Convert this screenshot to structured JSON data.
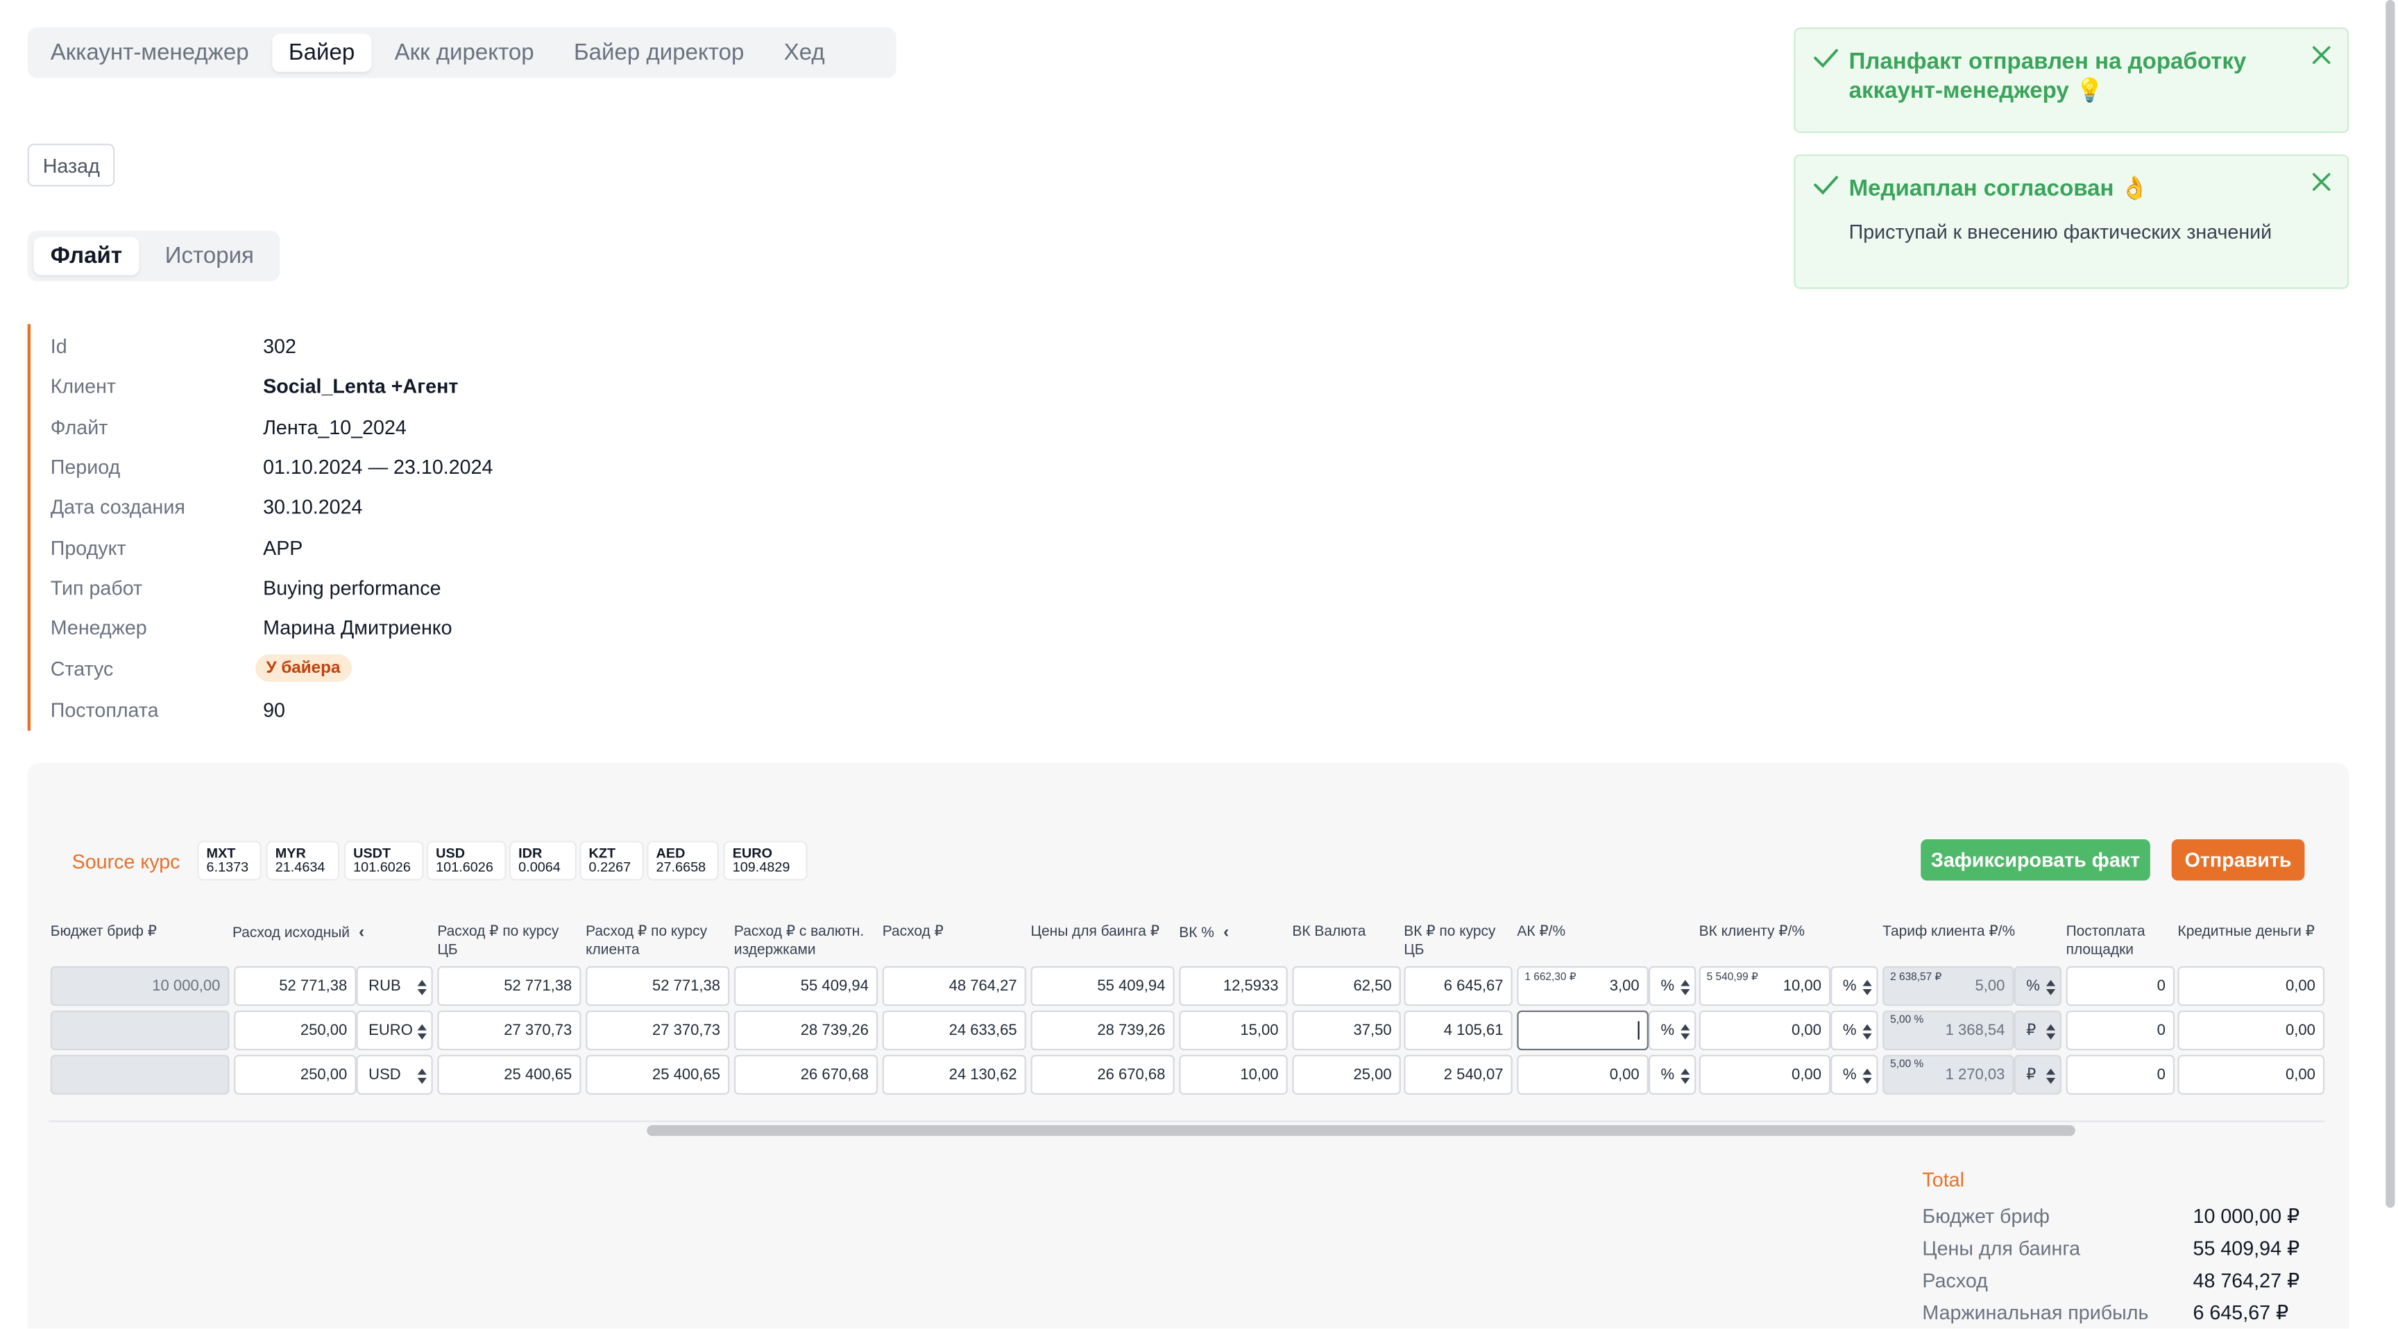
{
  "role_tabs": [
    {
      "label": "Аккаунт-менеджер",
      "active": false
    },
    {
      "label": "Байер",
      "active": true
    },
    {
      "label": "Акк директор",
      "active": false
    },
    {
      "label": "Байер директор",
      "active": false
    },
    {
      "label": "Хед",
      "active": false
    }
  ],
  "back_label": "Назад",
  "view_tabs": [
    {
      "label": "Флайт",
      "active": true
    },
    {
      "label": "История",
      "active": false
    }
  ],
  "info": [
    {
      "label": "Id",
      "value": "302"
    },
    {
      "label": "Клиент",
      "value": "Social_Lenta +Агент"
    },
    {
      "label": "Флайт",
      "value": "Лента_10_2024"
    },
    {
      "label": "Период",
      "value": "01.10.2024 — 23.10.2024"
    },
    {
      "label": "Дата создания",
      "value": "30.10.2024"
    },
    {
      "label": "Продукт",
      "value": "APP"
    },
    {
      "label": "Тип работ",
      "value": "Buying performance"
    },
    {
      "label": "Менеджер",
      "value": "Марина Дмитриенко"
    },
    {
      "label": "Статус",
      "value": "У байера"
    },
    {
      "label": "Постоплата",
      "value": "90"
    }
  ],
  "toasts": [
    {
      "title": "Планфакт отправлен на доработку аккаунт-менеджеру 💡",
      "desc": ""
    },
    {
      "title": "Медиаплан согласован 👌",
      "desc": "Приступай к внесению фактических значений"
    }
  ],
  "colors": {
    "accent": "#e8712a",
    "success": "#4fb96a",
    "status_bg": "#fdebd5"
  },
  "source_label": "Source курс",
  "rates": [
    {
      "code": "MXT",
      "value": "6.1373"
    },
    {
      "code": "MYR",
      "value": "21.4634"
    },
    {
      "code": "USDT",
      "value": "101.6026"
    },
    {
      "code": "USD",
      "value": "101.6026"
    },
    {
      "code": "IDR",
      "value": "0.0064"
    },
    {
      "code": "KZT",
      "value": "0.2267"
    },
    {
      "code": "AED",
      "value": "27.6658"
    },
    {
      "code": "EURO",
      "value": "109.4829"
    }
  ],
  "buttons": {
    "fix": "Зафиксировать факт",
    "send": "Отправить"
  },
  "columns": [
    "Бюджет бриф ₽",
    "Расход исходный",
    "Расход ₽ по курсу ЦБ",
    "Расход ₽ по курсу клиента",
    "Расход ₽ с валютн. издержками",
    "Расход ₽",
    "Цены для баинга ₽",
    "ВК %",
    "ВК Валюта",
    "ВК ₽ по курсу ЦБ",
    "АК ₽/%",
    "ВК клиенту ₽/%",
    "Тариф клиента ₽/%",
    "Постоплата площадки",
    "Кредитные деньги ₽"
  ],
  "rows": [
    {
      "budget": "10 000,00",
      "spend": "52 771,38",
      "currency": "RUB",
      "cb": "52 771,38",
      "client_rate": "52 771,38",
      "fx": "55 409,94",
      "rub": "48 764,27",
      "buying": "55 409,94",
      "vk_pct": "12,5933",
      "vk_cur": "62,50",
      "vk_cb": "6 645,67",
      "ak_hint": "1 662,30 ₽",
      "ak": "3,00",
      "ak_unit": "%",
      "vkc_hint": "5 540,99 ₽",
      "vkc": "10,00",
      "vkc_unit": "%",
      "tariff_hint": "2 638,57 ₽",
      "tariff": "5,00",
      "tariff_unit": "%",
      "post": "0",
      "credit": "0,00"
    },
    {
      "budget": "",
      "spend": "250,00",
      "currency": "EURO",
      "cb": "27 370,73",
      "client_rate": "27 370,73",
      "fx": "28 739,26",
      "rub": "24 633,65",
      "buying": "28 739,26",
      "vk_pct": "15,00",
      "vk_cur": "37,50",
      "vk_cb": "4 105,61",
      "ak_hint": "",
      "ak": "",
      "ak_unit": "%",
      "vkc_hint": "",
      "vkc": "0,00",
      "vkc_unit": "%",
      "tariff_hint": "5,00 %",
      "tariff": "1 368,54",
      "tariff_unit": "₽",
      "post": "0",
      "credit": "0,00"
    },
    {
      "budget": "",
      "spend": "250,00",
      "currency": "USD",
      "cb": "25 400,65",
      "client_rate": "25 400,65",
      "fx": "26 670,68",
      "rub": "24 130,62",
      "buying": "26 670,68",
      "vk_pct": "10,00",
      "vk_cur": "25,00",
      "vk_cb": "2 540,07",
      "ak_hint": "",
      "ak": "0,00",
      "ak_unit": "%",
      "vkc_hint": "",
      "vkc": "0,00",
      "vkc_unit": "%",
      "tariff_hint": "5,00 %",
      "tariff": "1 270,03",
      "tariff_unit": "₽",
      "post": "0",
      "credit": "0,00"
    }
  ],
  "total": {
    "title": "Total",
    "items": [
      {
        "label": "Бюджет бриф",
        "value": "10 000,00 ₽"
      },
      {
        "label": "Цены для баинга",
        "value": "55 409,94 ₽"
      },
      {
        "label": "Расход",
        "value": "48 764,27 ₽"
      },
      {
        "label": "Маржинальная прибыль",
        "value": "6 645,67 ₽"
      }
    ]
  },
  "icons": {
    "check": "check-icon",
    "close": "close-icon",
    "spinner": "spinner-icon",
    "chevron": "chevron-left-icon"
  }
}
